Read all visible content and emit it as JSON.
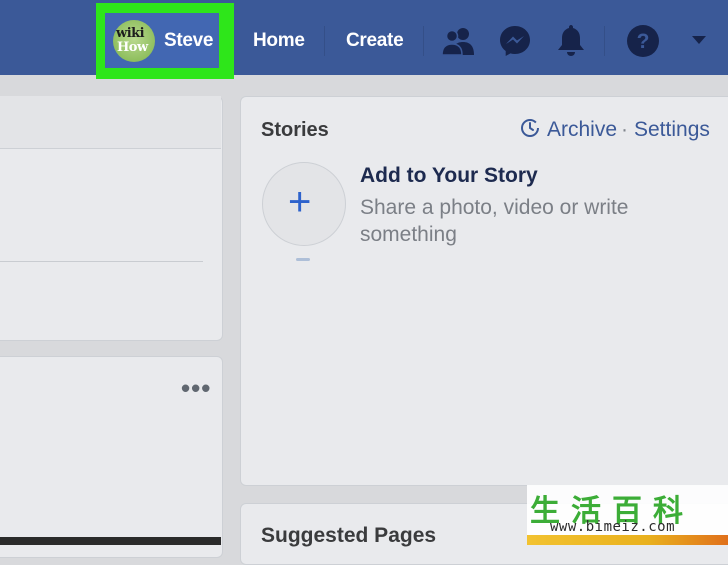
{
  "topbar": {
    "profile_name": "Steve",
    "avatar_text_top": "wiki",
    "avatar_text_bottom": "How",
    "nav_home": "Home",
    "nav_create": "Create",
    "icons": [
      "friends-icon",
      "messenger-icon",
      "notifications-bell-icon",
      "help-icon",
      "account-menu-caret-icon"
    ],
    "bar_color": "#3b5998",
    "highlight_color": "#2ee61a"
  },
  "stories": {
    "title": "Stories",
    "archive_label": "Archive",
    "separator": "·",
    "settings_label": "Settings",
    "add_story_title": "Add to Your Story",
    "add_story_description": "Share a photo, video or write something"
  },
  "suggested": {
    "title": "Suggested Pages"
  },
  "watermark": {
    "chars": "生活百科",
    "url": "www.bimeiz.com"
  }
}
